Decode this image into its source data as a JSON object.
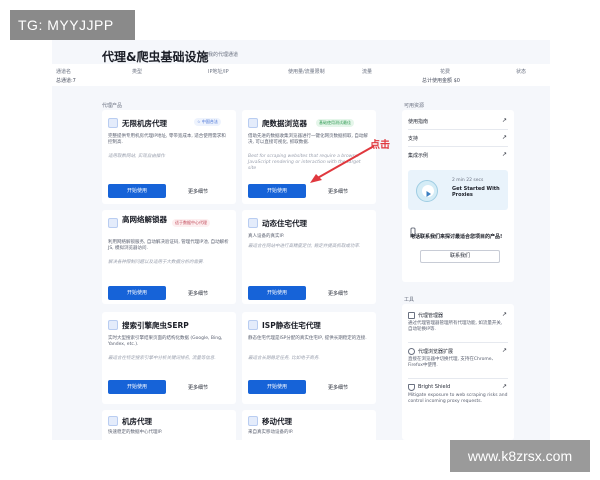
{
  "watermark_tl": "TG: MYYJJPP",
  "watermark_br": "www.k8zrsx.com",
  "header": {
    "title": "代理&爬虫基础设施",
    "subtitle": "我的代理通道"
  },
  "table": {
    "columns": [
      "通道名",
      "类型",
      "IP地址/IP",
      "使用量/流量限制",
      "流量",
      "花费",
      "状态"
    ],
    "summary": [
      "总通道:7",
      "总计使用金额 $0"
    ]
  },
  "sections": {
    "products": "代理产品",
    "tools_left": "可用资源",
    "tools_right": "工具"
  },
  "cards": [
    {
      "name": "无限机房代理",
      "badge": "☆ 中国合法",
      "desc": "完整提供专用机房代理IP地址, 零带宽成本, 适合使用需求和控制高.",
      "hint": "适用取数网站, 实现自由操作",
      "primary": "开始使用",
      "secondary": "更多细节"
    },
    {
      "name": "爬数据浏览器",
      "badge": "基础使用测试最佳",
      "desc": "借助先进的数据收集浏览器进行一键化网页数据抓取, 自动解决, 可以直接可视化, 抓取数据.",
      "hint": "Best for scraping websites that require a browser JavaScript rendering or interaction with the target site",
      "primary": "开始使用",
      "secondary": "更多细节"
    },
    {
      "name": "高网络解锁器",
      "badge": "适于数据中心代理",
      "desc": "利用网络解锁服务, 自动解决验证码, 管理代理IP池, 自动解析JS, 模拟浏览器访问.",
      "hint": "解决各种限制问题以及适用于大数据分析的需要.",
      "primary": "开始使用",
      "secondary": "更多细节"
    },
    {
      "name": "动态住宅代理",
      "badge": "",
      "desc": "真人设备的真实IP.",
      "hint": "最适合在网站中进行高精度定位, 稳定并提高抓取成功率.",
      "primary": "开始使用",
      "secondary": "更多细节"
    },
    {
      "name": "搜索引擎爬虫SERP",
      "badge": "",
      "desc": "实时大型搜索引擎结果页面的结构化数据 (Google, Bing, Yandex, etc.).",
      "hint": "最适合在特定搜索引擎中分析关键词排名, 流量等信息.",
      "primary": "开始使用",
      "secondary": "更多细节"
    },
    {
      "name": "ISP静态住宅代理",
      "badge": "",
      "desc": "静态住宅代理是ISP分配的真实住宅IP, 提供长期稳定的连接.",
      "hint": "最适合长期稳定任务, 比如电子商务.",
      "primary": "开始使用",
      "secondary": "更多细节"
    },
    {
      "name": "机房代理",
      "desc": "快速稳定的数据中心代理IP."
    },
    {
      "name": "移动代理",
      "desc": "来自真实移动设备的IP."
    }
  ],
  "annotation": "点击",
  "resources": {
    "links": [
      "使用指南",
      "支持",
      "集成示例"
    ],
    "video": {
      "meta": "2 min 22 secs",
      "title": "Get Started With Proxies"
    },
    "phone": {
      "text": "电话联系我们来探讨最适合您项目的产品!",
      "button": "联系我们"
    }
  },
  "tools": {
    "items": [
      {
        "name": "代理管理器",
        "desc": "通过代理管理器管理所有代理功能, 如流量开关, 自动轮换IP等."
      },
      {
        "name": "代理浏览器扩展",
        "desc": "直接在浏览器中切换代理, 支持在Chrome、Firefox中使用."
      },
      {
        "name": "Bright Shield",
        "desc": "Mitigate exposure to web scraping risks and control incoming proxy requests."
      }
    ]
  },
  "colors": {
    "accent": "#1663d8",
    "annotation": "#e0383e"
  }
}
